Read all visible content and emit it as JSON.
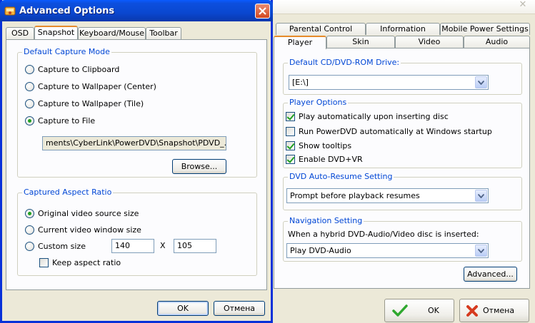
{
  "right_window": {
    "tabs_row1": [
      "Parental Control",
      "Information",
      "Mobile Power Settings"
    ],
    "tabs_row2": [
      "Player",
      "Skin",
      "Video",
      "Audio"
    ],
    "active_tab": "Player",
    "drive_group": {
      "legend": "Default CD/DVD-ROM Drive:",
      "value": "[E:\\]"
    },
    "player_options": {
      "legend": "Player Options",
      "items": [
        {
          "label": "Play automatically upon inserting disc",
          "checked": true
        },
        {
          "label": "Run PowerDVD automatically at Windows startup",
          "checked": false
        },
        {
          "label": "Show tooltips",
          "checked": true
        },
        {
          "label": "Enable DVD+VR",
          "checked": true
        }
      ]
    },
    "auto_resume": {
      "legend": "DVD Auto-Resume Setting",
      "value": "Prompt before playback resumes"
    },
    "navigation": {
      "legend": "Navigation Setting",
      "description": "When a hybrid DVD-Audio/Video disc is inserted:",
      "value": "Play DVD-Audio"
    },
    "advanced_label": "Advanced...",
    "ok_label": "OK",
    "cancel_label": "Отмена"
  },
  "dialog": {
    "title": "Advanced Options",
    "tabs": [
      "OSD",
      "Snapshot",
      "Keyboard/Mouse",
      "Toolbar"
    ],
    "active_tab": "Snapshot",
    "capture_mode": {
      "legend": "Default Capture Mode",
      "options": [
        "Capture to Clipboard",
        "Capture to Wallpaper (Center)",
        "Capture to Wallpaper (Tile)",
        "Capture to File"
      ],
      "selected": "Capture to File",
      "file_path": "ments\\CyberLink\\PowerDVD\\Snapshot\\PDVD_.BMP",
      "browse_label": "Browse..."
    },
    "aspect_ratio": {
      "legend": "Captured Aspect Ratio",
      "options": [
        "Original video source size",
        "Current video window size",
        "Custom size"
      ],
      "selected": "Original video source size",
      "width_value": "140",
      "times_sign": "X",
      "height_value": "105",
      "keep_aspect_label": "Keep aspect ratio",
      "keep_aspect_checked": false
    },
    "ok_label": "OK",
    "cancel_label": "Отмена"
  },
  "colors": {
    "title_blue": "#0a47d0",
    "legend_blue": "#0046d5",
    "active_tab_orange": "#e68b2c",
    "check_green": "#21a121",
    "close_red": "#d4481f"
  }
}
